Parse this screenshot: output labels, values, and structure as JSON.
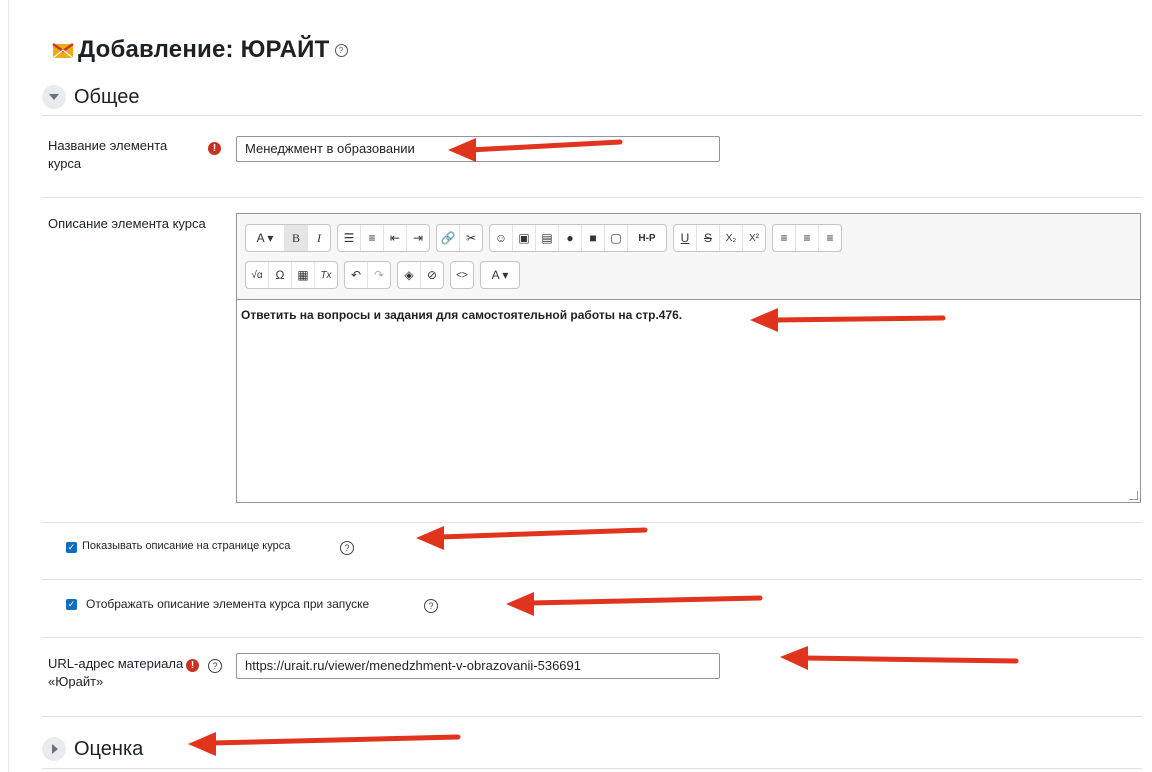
{
  "page": {
    "title": "Добавление: ЮРАЙТ",
    "help_glyph": "?"
  },
  "sections": {
    "general": "Общее",
    "grade": "Оценка"
  },
  "form": {
    "name_label": "Название элемента курса",
    "name_value": "Менеджмент в образовании",
    "description_label": "Описание элемента курса",
    "description_content": "Ответить на вопросы и задания для самостоятельной работы на стр.476.",
    "show_description_label": "Показывать описание на странице курса",
    "show_description_checked": true,
    "display_on_launch_label": "Отображать описание элемента курса при запуске",
    "display_on_launch_checked": true,
    "url_label": "URL-адрес материала «Юрайт»",
    "url_value": "https://urait.ru/viewer/menedzhment-v-obrazovanii-536691",
    "required_glyph": "!"
  },
  "toolbar": {
    "row1": [
      {
        "name": "font-style-dropdown",
        "glyph": "A ▾"
      },
      {
        "name": "bold-button",
        "glyph": "B"
      },
      {
        "name": "italic-button",
        "glyph": "I"
      },
      {
        "name": "unordered-list-button",
        "glyph": "☰"
      },
      {
        "name": "ordered-list-button",
        "glyph": "≡"
      },
      {
        "name": "outdent-button",
        "glyph": "⇤"
      },
      {
        "name": "indent-button",
        "glyph": "⇥"
      },
      {
        "name": "link-button",
        "glyph": "🔗"
      },
      {
        "name": "unlink-button",
        "glyph": "✂"
      },
      {
        "name": "emoji-button",
        "glyph": "☺"
      },
      {
        "name": "image-button",
        "glyph": "▣"
      },
      {
        "name": "media-button",
        "glyph": "▤"
      },
      {
        "name": "record-audio-button",
        "glyph": "●"
      },
      {
        "name": "record-video-button",
        "glyph": "■"
      },
      {
        "name": "manage-files-button",
        "glyph": "▢"
      },
      {
        "name": "h5p-button",
        "glyph": "H-P"
      },
      {
        "name": "underline-button",
        "glyph": "U"
      },
      {
        "name": "strikethrough-button",
        "glyph": "S"
      },
      {
        "name": "subscript-button",
        "glyph": "X₂"
      },
      {
        "name": "superscript-button",
        "glyph": "X²"
      },
      {
        "name": "align-left-button",
        "glyph": "≡"
      },
      {
        "name": "align-center-button",
        "glyph": "≡"
      },
      {
        "name": "align-right-button",
        "glyph": "≡"
      }
    ],
    "row2": [
      {
        "name": "equation-button",
        "glyph": "√α"
      },
      {
        "name": "special-char-button",
        "glyph": "Ω"
      },
      {
        "name": "table-button",
        "glyph": "▦"
      },
      {
        "name": "clear-format-button",
        "glyph": "Tx"
      },
      {
        "name": "undo-button",
        "glyph": "↶"
      },
      {
        "name": "redo-button",
        "glyph": "↷"
      },
      {
        "name": "accessibility-checker-button",
        "glyph": "◈"
      },
      {
        "name": "screenreader-helper-button",
        "glyph": "⊘"
      },
      {
        "name": "html-button",
        "glyph": "<>"
      },
      {
        "name": "text-color-dropdown",
        "glyph": "A ▾"
      }
    ]
  },
  "colors": {
    "accent": "#0f6cbf",
    "required": "#ca3120",
    "arrow": "#e1341e"
  }
}
